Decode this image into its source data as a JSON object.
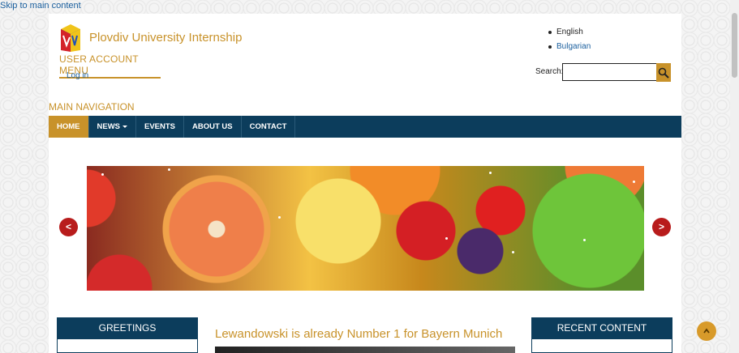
{
  "skip_link": "Skip to main content",
  "header": {
    "site_name": "Plovdiv University Internship",
    "user_menu_title": "USER ACCOUNT MENU",
    "login_label": "Log in"
  },
  "languages": {
    "english": "English",
    "bulgarian": "Bulgarian"
  },
  "search": {
    "label": "Search:",
    "value": "",
    "button_icon": "search-icon"
  },
  "main_nav": {
    "title": "MAIN NAVIGATION",
    "items": [
      {
        "label": "HOME",
        "active": true
      },
      {
        "label": "NEWS",
        "has_dropdown": true
      },
      {
        "label": "EVENTS"
      },
      {
        "label": "ABOUT US"
      },
      {
        "label": "CONTACT"
      }
    ]
  },
  "slider": {
    "prev_label": "<",
    "next_label": ">",
    "image": "fruit-banner"
  },
  "blocks": {
    "greetings_title": "GREETINGS",
    "recent_title": "RECENT CONTENT"
  },
  "article": {
    "title": "Lewandowski is already Number 1 for Bayern Munich"
  },
  "back_to_top_icon": "chevron-up-icon",
  "colors": {
    "accent": "#c8922a",
    "nav_bg": "#0c3d5c",
    "arrow_red": "#b81c1c",
    "link": "#1a5f9e"
  }
}
